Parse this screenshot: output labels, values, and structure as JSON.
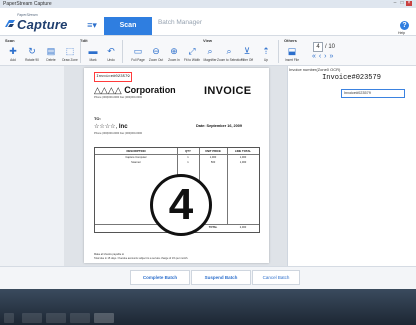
{
  "window": {
    "title": "PaperStream Capture"
  },
  "header": {
    "logo_subtext": "PaperStream",
    "logo_text": "Capture",
    "tabs": [
      {
        "label": "Scan",
        "active": true
      },
      {
        "label": "Batch Manager",
        "active": false
      }
    ],
    "help_label": "Help"
  },
  "toolbar": {
    "groups": {
      "scan": "Scan",
      "edit": "Edit",
      "view": "View",
      "others": "Others"
    },
    "buttons": {
      "add": "Add",
      "rotate": "Rotate 90",
      "delete": "Delete",
      "draw_zone": "Draw Zone",
      "mark": "Mark",
      "undo": "Undo",
      "full_page": "Full Page",
      "zoom_out": "Zoom Out",
      "zoom_in": "Zoom In",
      "fit": "Fit to Width",
      "magnifier": "Magnifier",
      "zoom_selection": "Zoom to Selection",
      "filter_off": "Filter Off",
      "up": "Up",
      "insert_file": "Insert File"
    },
    "page": {
      "current": "4",
      "total": "/ 10"
    }
  },
  "document": {
    "invoice_number": "Invoice#023579",
    "company": "Corporation",
    "company_phone": "Phone (000)000-0000  Fax (000)000-0000",
    "invoice_title": "INVOICE",
    "to_label": "TO:",
    "customer": "Inc",
    "customer_phone": "Phone (000)000-0000  Fax (000)000-0000",
    "date_line": "Date: September 16, 2009",
    "table": {
      "headers": [
        "DESCRIPTION",
        "QTY",
        "UNIT PRICE",
        "LINE TOTAL"
      ],
      "rows": [
        [
          "Capture Computer",
          "1",
          "1,000",
          "1,000"
        ],
        [
          "Scanner",
          "1",
          "500",
          "1,000"
        ]
      ],
      "total_label": "TOTAL",
      "total_value": "2,000"
    },
    "separator_number": "4",
    "notes": "Make all checks payable to\nTotal due in 15 days. Overdue accounts subject to a service charge of 1% per month.",
    "thanks": "Thank you for your business!",
    "footer": "PaperStream Capture Sales  (000)000-0000"
  },
  "index_panel": {
    "zone_label": "Invoice number(Zone0 OCR)",
    "ocr_value": "Invoice#023579",
    "field_value": "Invoice#023579"
  },
  "footer_buttons": {
    "complete": "Complete Batch",
    "suspend": "Suspend Batch",
    "cancel": "Cancel Batch"
  }
}
